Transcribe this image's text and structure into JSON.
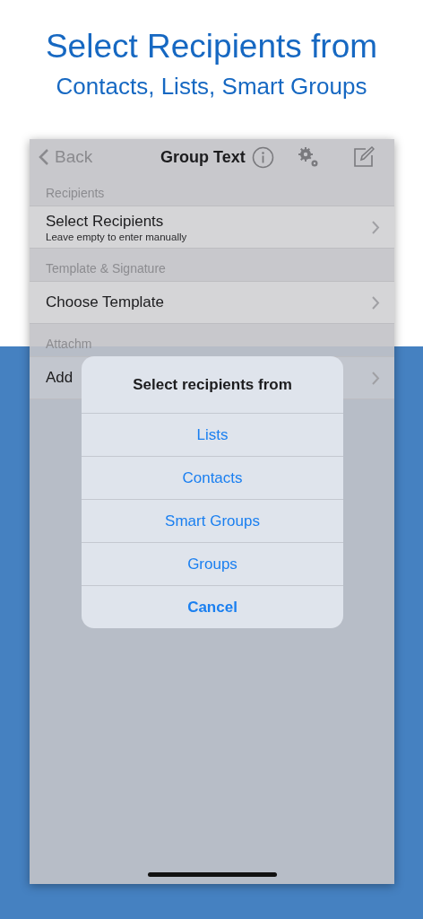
{
  "headline": {
    "title": "Select Recipients from",
    "subtitle": "Contacts, Lists, Smart Groups"
  },
  "nav": {
    "back": "Back",
    "title": "Group Text"
  },
  "sections": [
    {
      "header": "Recipients",
      "rows": [
        {
          "title": "Select Recipients",
          "subtitle": "Leave empty to enter manually"
        }
      ]
    },
    {
      "header": "Template & Signature",
      "rows": [
        {
          "title": "Choose Template"
        }
      ]
    },
    {
      "header": "Attachm",
      "rows": [
        {
          "title": "Add"
        }
      ]
    }
  ],
  "alert": {
    "title": "Select recipients from",
    "actions": [
      {
        "label": "Lists",
        "kind": "default"
      },
      {
        "label": "Contacts",
        "kind": "default"
      },
      {
        "label": "Smart Groups",
        "kind": "default"
      },
      {
        "label": "Groups",
        "kind": "default"
      },
      {
        "label": "Cancel",
        "kind": "cancel"
      }
    ]
  }
}
